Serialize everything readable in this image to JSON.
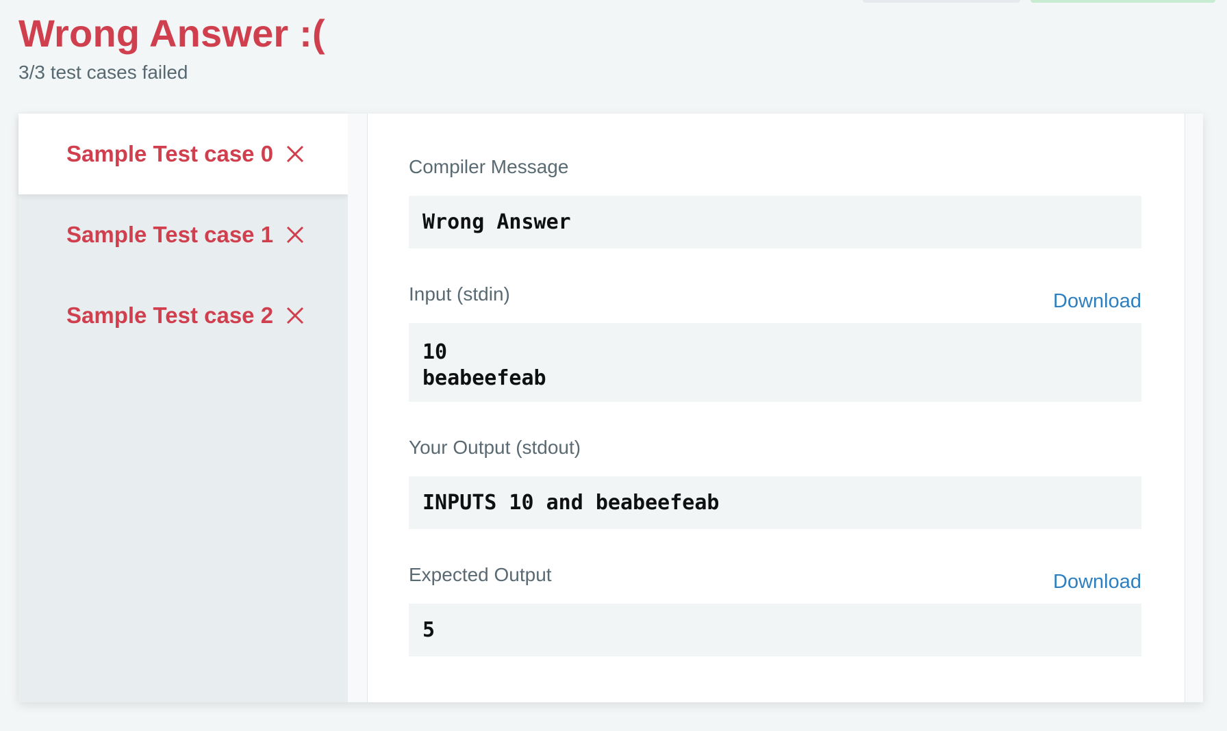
{
  "header": {
    "title": "Wrong Answer :(",
    "subtitle": "3/3 test cases failed"
  },
  "tabs": [
    {
      "label": "Sample Test case 0",
      "status": "failed",
      "active": true
    },
    {
      "label": "Sample Test case 1",
      "status": "failed",
      "active": false
    },
    {
      "label": "Sample Test case 2",
      "status": "failed",
      "active": false
    }
  ],
  "details": {
    "compiler_message": {
      "label": "Compiler Message",
      "value": "Wrong Answer"
    },
    "input": {
      "label": "Input (stdin)",
      "value": "10\nbeabeefeab",
      "download_label": "Download"
    },
    "your_output": {
      "label": "Your Output (stdout)",
      "value": "INPUTS 10 and beabeefeab"
    },
    "expected_output": {
      "label": "Expected Output",
      "value": "5",
      "download_label": "Download"
    }
  },
  "colors": {
    "error": "#d03f4e",
    "link": "#2e7fbf",
    "code_background": "#f2f5f6",
    "page_background": "#f3f6f7"
  },
  "icons": {
    "tab_status": "close-x-icon"
  }
}
